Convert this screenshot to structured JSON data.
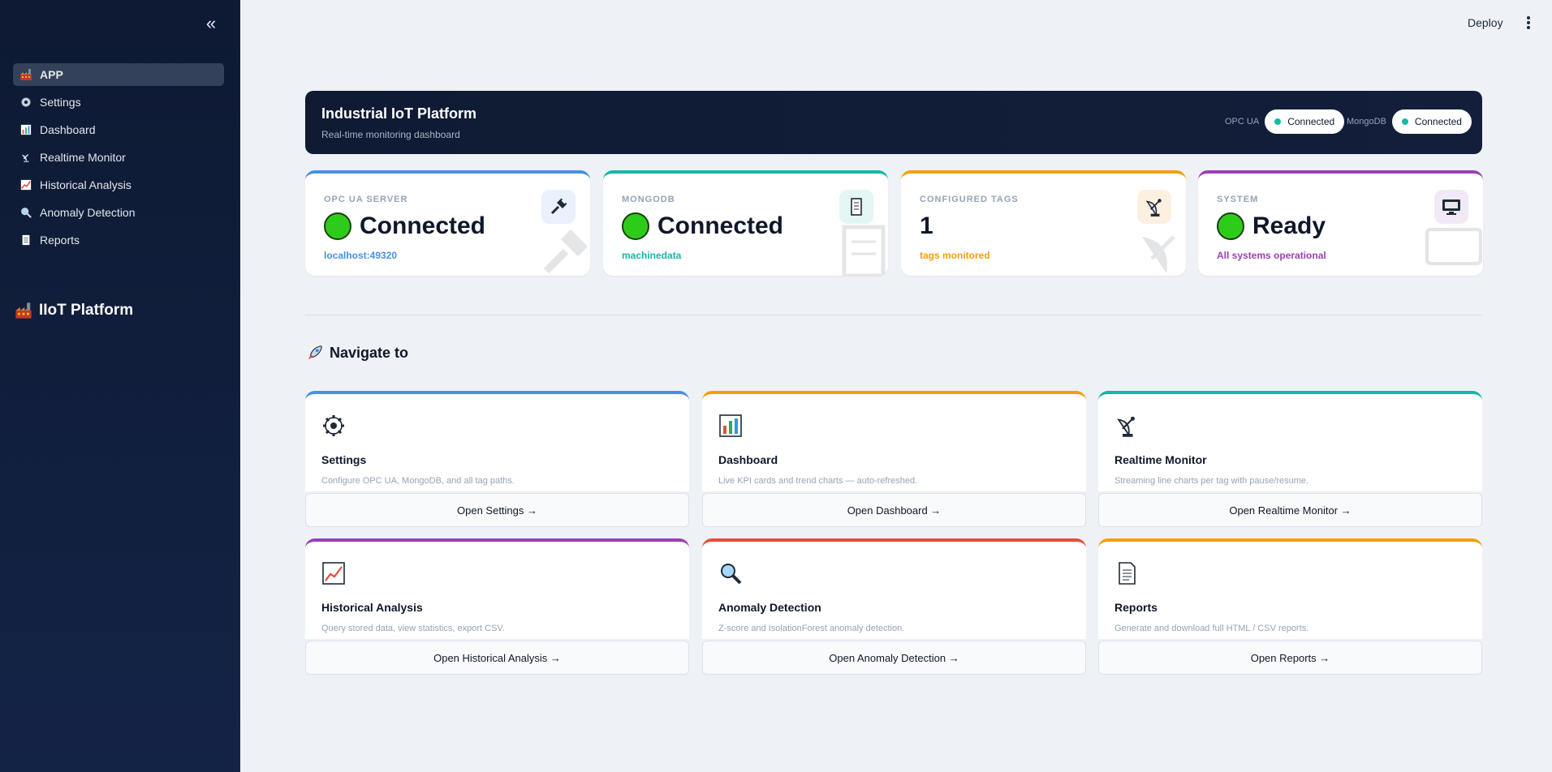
{
  "sidebar": {
    "items": [
      {
        "label": "APP",
        "icon": "factory-icon",
        "active": true
      },
      {
        "label": "Settings",
        "icon": "gear-icon"
      },
      {
        "label": "Dashboard",
        "icon": "bar-chart-icon"
      },
      {
        "label": "Realtime Monitor",
        "icon": "satellite-dish-icon"
      },
      {
        "label": "Historical Analysis",
        "icon": "trend-chart-icon"
      },
      {
        "label": "Anomaly Detection",
        "icon": "magnifier-icon"
      },
      {
        "label": "Reports",
        "icon": "document-icon"
      }
    ],
    "brand": "IIoT Platform"
  },
  "topbar": {
    "deploy_label": "Deploy"
  },
  "banner": {
    "title": "Industrial IoT Platform",
    "subtitle": "Real-time monitoring dashboard",
    "opc_label": "OPC UA",
    "opc_status": "Connected",
    "mongo_label": "MongoDB",
    "mongo_status": "Connected"
  },
  "kpis": [
    {
      "label": "OPC UA SERVER",
      "value": "Connected",
      "sub": "localhost:49320",
      "accent": "#4a90e2",
      "sub_color": "#4a90e2",
      "icon": "plug-icon"
    },
    {
      "label": "MONGODB",
      "value": "Connected",
      "sub": "machinedata",
      "accent": "#14b8a6",
      "sub_color": "#14b8a6",
      "icon": "database-icon"
    },
    {
      "label": "CONFIGURED TAGS",
      "value": "1",
      "sub": "tags monitored",
      "accent": "#f59e0b",
      "sub_color": "#f59e0b",
      "icon": "satellite-dish-icon"
    },
    {
      "label": "SYSTEM",
      "value": "Ready",
      "sub": "All systems operational",
      "accent": "#9b3fb5",
      "sub_color": "#9b3fb5",
      "icon": "monitor-icon"
    }
  ],
  "navigate": {
    "heading": "Navigate to",
    "cards": [
      {
        "title": "Settings",
        "desc": "Configure OPC UA, MongoDB, and all tag paths.",
        "button": "Open Settings →",
        "accent": "#4a90e2",
        "icon": "gear-icon"
      },
      {
        "title": "Dashboard",
        "desc": "Live KPI cards and trend charts — auto-refreshed.",
        "button": "Open Dashboard →",
        "accent": "#f59e0b",
        "icon": "bar-chart-icon"
      },
      {
        "title": "Realtime Monitor",
        "desc": "Streaming line charts per tag with pause/resume.",
        "button": "Open Realtime Monitor →",
        "accent": "#14b8a6",
        "icon": "satellite-dish-icon"
      },
      {
        "title": "Historical Analysis",
        "desc": "Query stored data, view statistics, export CSV.",
        "button": "Open Historical Analysis →",
        "accent": "#9b3fb5",
        "icon": "trend-chart-icon"
      },
      {
        "title": "Anomaly Detection",
        "desc": "Z-score and IsolationForest anomaly detection.",
        "button": "Open Anomaly Detection →",
        "accent": "#e74c3c",
        "icon": "magnifier-icon"
      },
      {
        "title": "Reports",
        "desc": "Generate and download full HTML / CSV reports.",
        "button": "Open Reports →",
        "accent": "#f59e0b",
        "icon": "document-icon"
      }
    ]
  }
}
